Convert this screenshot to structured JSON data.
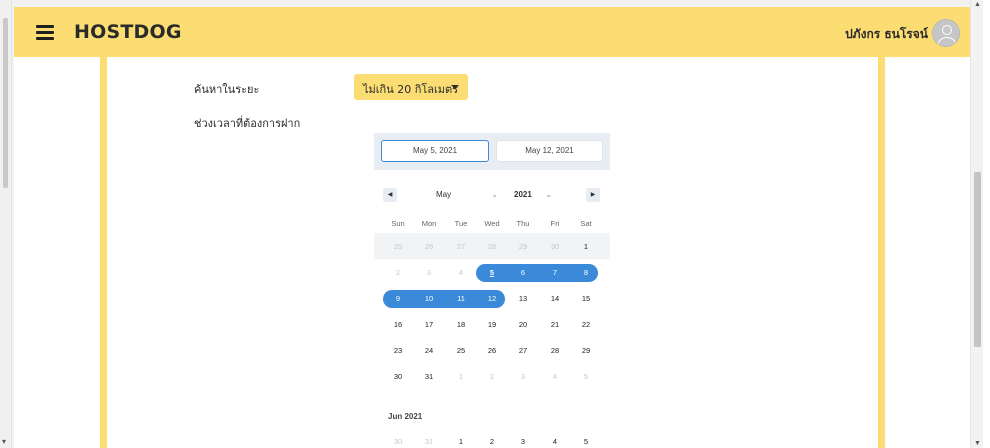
{
  "navbar": {
    "brand": "HOSTDOG",
    "username": "ปภังกร ธนโรจน์"
  },
  "search": {
    "range_label": "ค้นหาในระยะ",
    "range_value": "ไม่เกิน 20 กิโลเมตร",
    "time_label": "ช่วงเวลาที่ต้องการฝาก"
  },
  "calendar": {
    "start_date": "May 5, 2021",
    "end_date": "May 12, 2021",
    "month": "May",
    "year": "2021",
    "weekdays": [
      "Sun",
      "Mon",
      "Tue",
      "Wed",
      "Thu",
      "Fri",
      "Sat"
    ],
    "weeks": [
      [
        "25",
        "26",
        "27",
        "28",
        "29",
        "30",
        "1"
      ],
      [
        "2",
        "3",
        "4",
        "5",
        "6",
        "7",
        "8"
      ],
      [
        "9",
        "10",
        "11",
        "12",
        "13",
        "14",
        "15"
      ],
      [
        "16",
        "17",
        "18",
        "19",
        "20",
        "21",
        "22"
      ],
      [
        "23",
        "24",
        "25",
        "26",
        "27",
        "28",
        "29"
      ],
      [
        "30",
        "31",
        "1",
        "2",
        "3",
        "4",
        "5"
      ]
    ],
    "next_month_label": "Jun 2021",
    "next_month_first_week": [
      "30",
      "31",
      "1",
      "2",
      "3",
      "4",
      "5"
    ]
  },
  "colors": {
    "brand_yellow": "#fbdd73",
    "range_blue": "#3b8ad9"
  },
  "icons": {
    "menu": "hamburger-icon",
    "avatar": "user-avatar-icon",
    "prev": "triangle-left-icon",
    "next": "triangle-right-icon"
  }
}
